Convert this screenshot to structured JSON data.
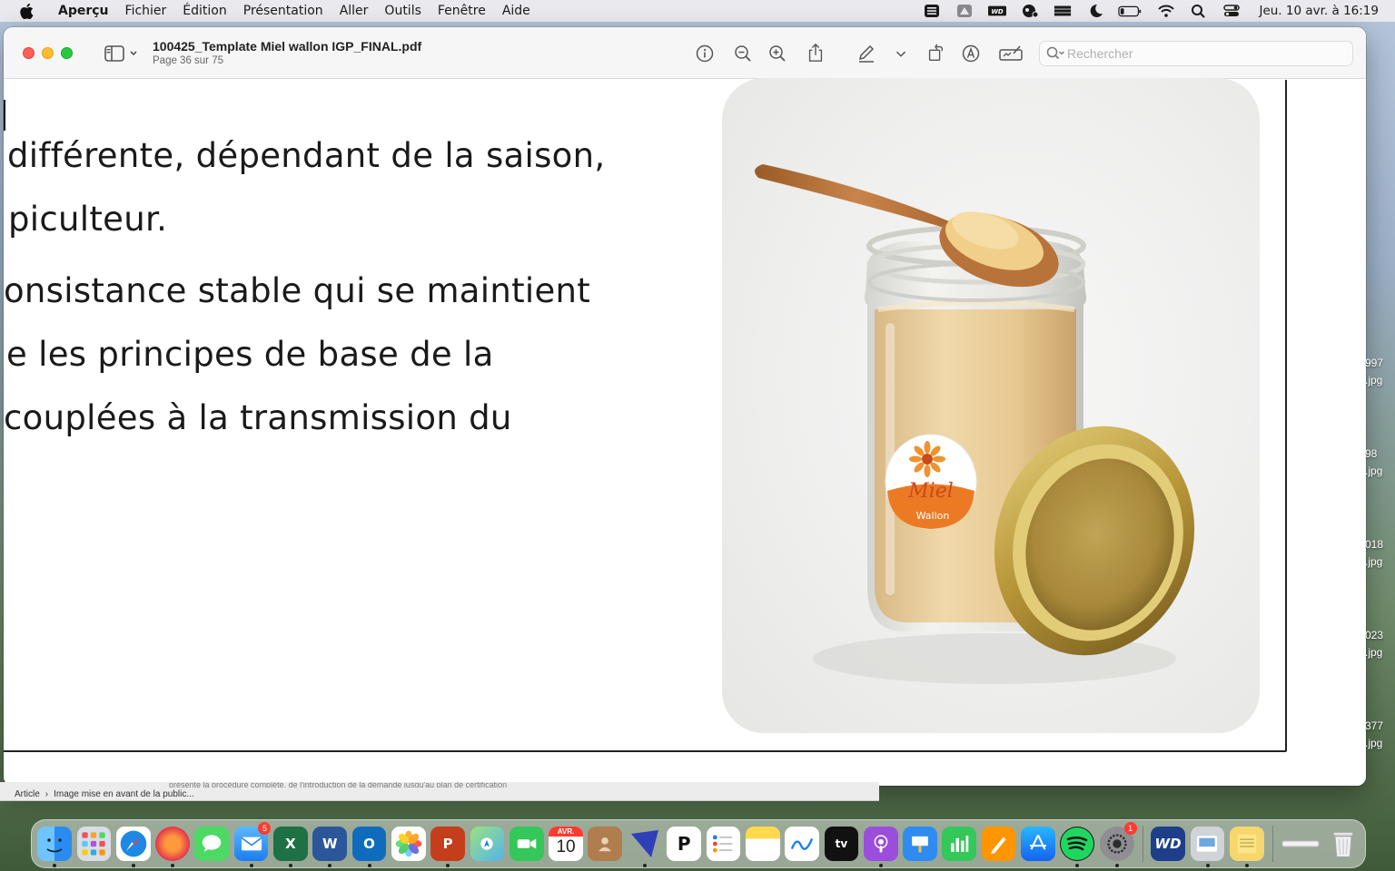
{
  "menubar": {
    "app_name": "Aperçu",
    "menus": [
      "Fichier",
      "Édition",
      "Présentation",
      "Aller",
      "Outils",
      "Fenêtre",
      "Aide"
    ],
    "clock": "Jeu. 10 avr. à 16:19",
    "status_icons": [
      "notes-menu-icon",
      "backup-drive-icon",
      "wd-drive-icon",
      "spy-helper-icon",
      "stack-icon",
      "do-not-disturb-moon-icon",
      "battery-icon",
      "wifi-icon",
      "spotlight-search-icon",
      "control-center-icon"
    ]
  },
  "window": {
    "doc_title": "100425_Template Miel wallon IGP_FINAL.pdf",
    "page_info": "Page 36 sur 75",
    "search_placeholder": "Rechercher"
  },
  "document": {
    "lines": [
      " différente, dépendant de la saison,",
      "piculteur.",
      "onsistance stable qui se maintient",
      "e les principes de base de la",
      "couplées à la transmission du"
    ],
    "photo": {
      "label_brand": "Miel",
      "label_sub": "Wallon",
      "colors": {
        "honey": "#e6c795",
        "lid_gold": "#b89a45",
        "label_orange": "#ec7a25",
        "spoon_wood": "#b8733a"
      }
    }
  },
  "background_window": {
    "ghost_text": "présente la procédure complète, de l'introduction de la demande jusqu'au plan de certification",
    "breadcrumb": [
      "Article",
      "Image mise en avant de la public..."
    ]
  },
  "desktop_files": [
    {
      "line1": "997",
      "line2": ".jpg"
    },
    {
      "line1": "98",
      "line2": ".jpg"
    },
    {
      "line1": "018",
      "line2": ".jpg"
    },
    {
      "line1": "023",
      "line2": ".jpg"
    },
    {
      "line1": "377",
      "line2": ".jpg"
    }
  ],
  "dock": {
    "calendar_month": "AVR.",
    "calendar_day": "10",
    "mail_badge": "5",
    "settings_badge": "1"
  }
}
